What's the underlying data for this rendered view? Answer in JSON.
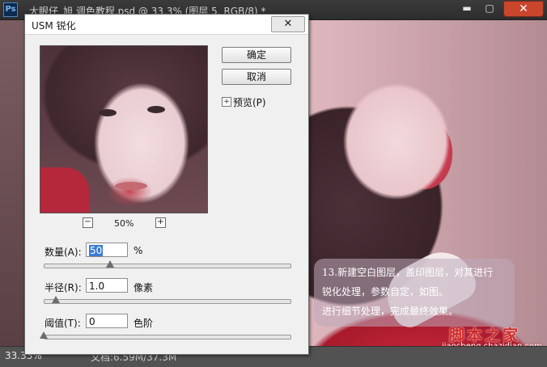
{
  "app": {
    "logo_text": "Ps",
    "document_title": "大眼仔_旭 调色教程.psd @ 33.3% (图层 5, RGB/8) *",
    "window_buttons": {
      "minimize": "▬",
      "maximize": "▢",
      "close": "✕"
    }
  },
  "canvas": {
    "note_lines": [
      "13.新建空白图层，盖印图层，对其进行",
      "锐化处理，参数自定，如图。",
      "进行细节处理，完成最终效果。"
    ],
    "watermark_text": "脚本之家",
    "watermark_url": "jiaocheng.chazidian.com"
  },
  "status_bar": {
    "zoom": "33.33%",
    "doc_info": "文档:6.59M/37.3M"
  },
  "dialog": {
    "title": "USM 锐化",
    "close_symbol": "✕",
    "ok_label": "确定",
    "cancel_label": "取消",
    "preview_toggle_symbol": "+",
    "preview_label": "预览(P)",
    "zoom_minus": "−",
    "zoom_plus": "+",
    "zoom_level": "50%",
    "params": [
      {
        "label": "数量(A):",
        "value": "50",
        "unit": "%",
        "slider_fraction": 0.27
      },
      {
        "label": "半径(R):",
        "value": "1.0",
        "unit": "像素",
        "slider_fraction": 0.05
      },
      {
        "label": "阈值(T):",
        "value": "0",
        "unit": "色阶",
        "slider_fraction": 0.0
      }
    ]
  },
  "colors": {
    "ps_chrome": "#2d2d2d",
    "dialog_bg": "#f0f0f0",
    "selection": "#3a7ad6",
    "close_button": "#c9462c",
    "watermark": "#d22a2a"
  }
}
